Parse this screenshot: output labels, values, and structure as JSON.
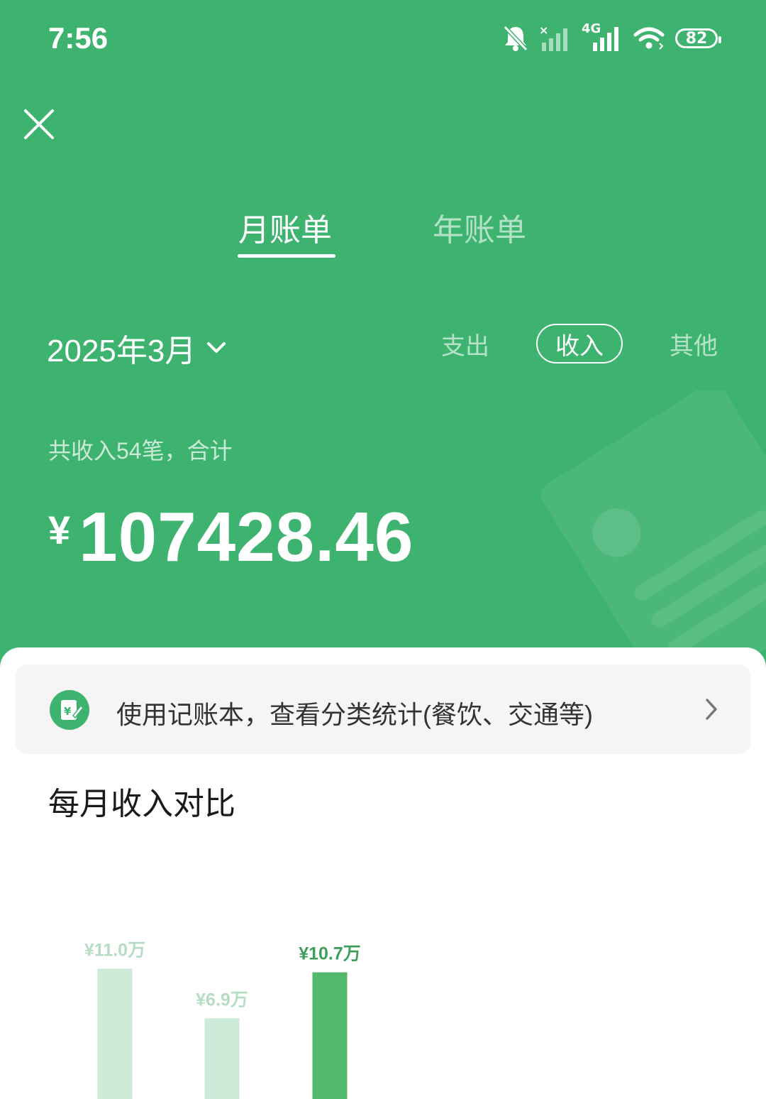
{
  "status_bar": {
    "time": "7:56",
    "network": "4G",
    "battery": "82",
    "icons": [
      "bell-muted-icon",
      "signal-x-icon",
      "signal-4g-icon",
      "wifi-icon",
      "battery-icon"
    ]
  },
  "header": {
    "close_icon": "close-icon",
    "tabs": [
      {
        "label": "月账单",
        "active": true
      },
      {
        "label": "年账单",
        "active": false
      }
    ]
  },
  "filters": {
    "period": "2025年3月",
    "options": [
      {
        "label": "支出",
        "active": false
      },
      {
        "label": "收入",
        "active": true
      },
      {
        "label": "其他",
        "active": false
      }
    ]
  },
  "summary": {
    "text": "共收入54笔，合计",
    "currency": "¥",
    "amount": "107428.46"
  },
  "promo": {
    "text": "使用记账本，查看分类统计(餐饮、交通等)",
    "icon": "ledger-icon"
  },
  "chart_title": "每月收入对比",
  "colors": {
    "brand": "#3eb370",
    "bar_active": "#52b96c",
    "bar_inactive": "#cdebd8",
    "label_inactive": "#b6dcc3",
    "label_active": "#3e9f5d"
  },
  "chart_data": {
    "type": "bar",
    "values": [
      11.0,
      6.9,
      10.7
    ],
    "labels": [
      "¥11.0万",
      "¥6.9万",
      "¥10.7万"
    ],
    "active_index": 2
  }
}
